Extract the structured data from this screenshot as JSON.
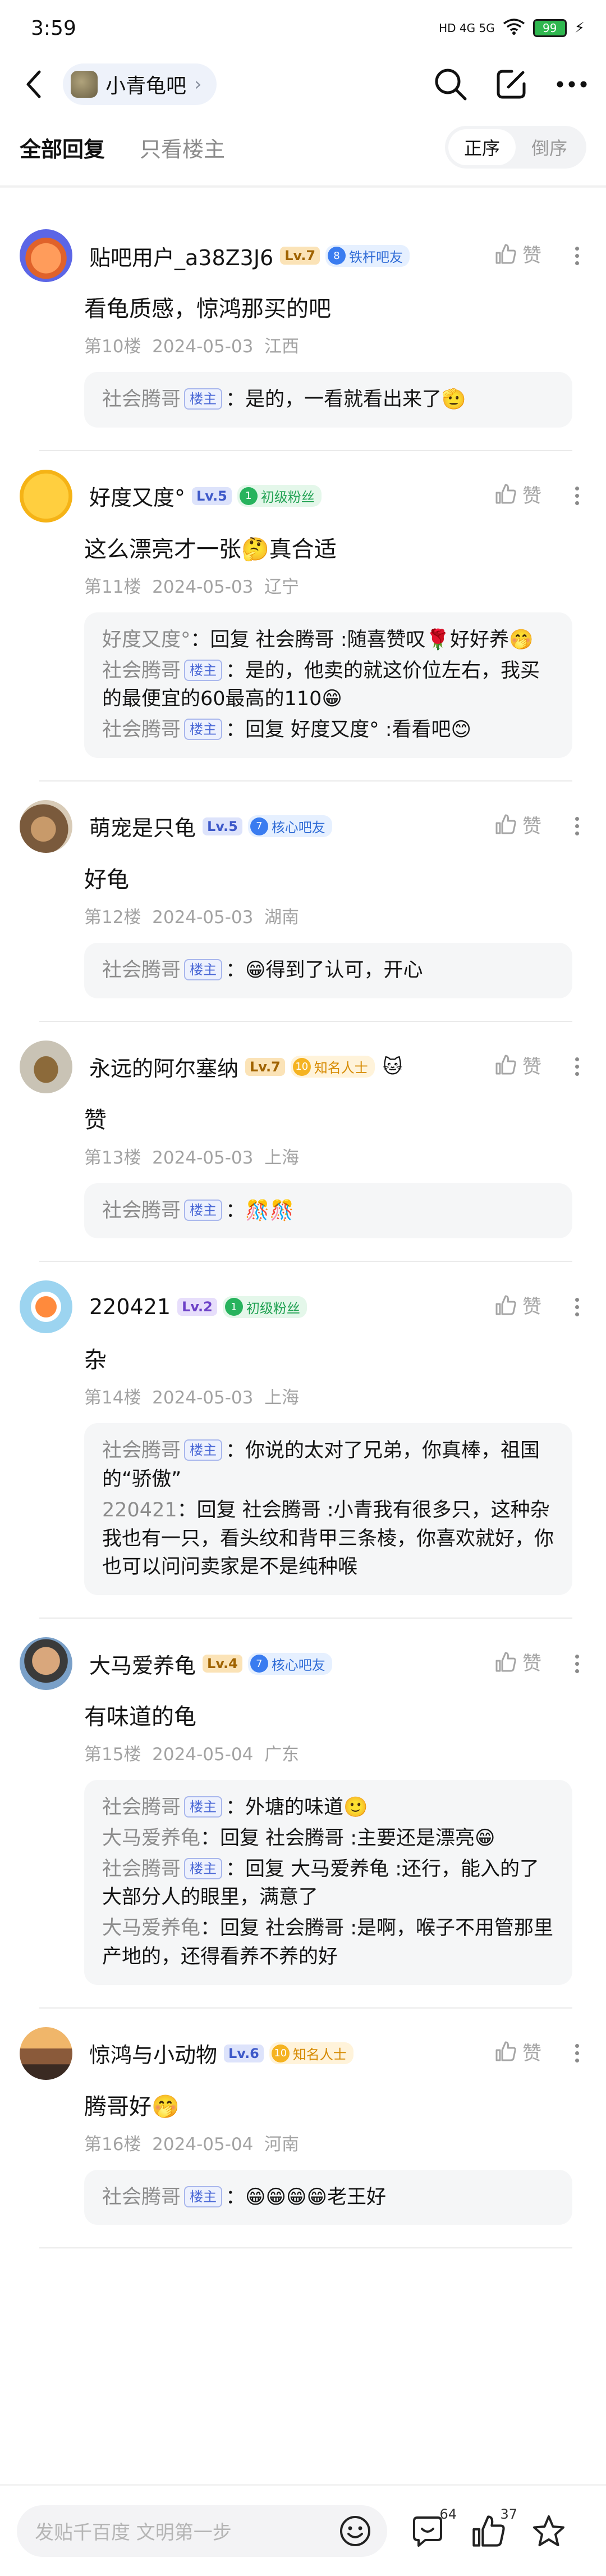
{
  "status": {
    "time": "3:59",
    "signal": "HD 4G 5G",
    "battery": "99"
  },
  "nav": {
    "forum_name": "小青龟吧",
    "chevron": "›"
  },
  "filters": {
    "tabs": [
      "全部回复",
      "只看楼主"
    ],
    "sort": [
      "正序",
      "倒序"
    ]
  },
  "posts": [
    {
      "username": "贴吧用户_a38Z3J6",
      "level": "Lv.7",
      "badge_num": "8",
      "badge": "铁杆吧友",
      "badge_extra": "",
      "like": "赞",
      "content": "看龟质感，惊鸿那买的吧",
      "floor": "第10楼",
      "date": "2024-05-03",
      "location": "江西",
      "replies": [
        {
          "name": "社会腾哥",
          "owner": "楼主",
          "text": "：是的，一看就看出来了🫡"
        }
      ]
    },
    {
      "username": "好度又度°",
      "level": "Lv.5",
      "badge_num": "1",
      "badge": "初级粉丝",
      "badge_extra": "",
      "like": "赞",
      "content": "这么漂亮才一张🤔真合适",
      "floor": "第11楼",
      "date": "2024-05-03",
      "location": "辽宁",
      "replies": [
        {
          "name": "好度又度°",
          "owner": "",
          "text": "：回复 社会腾哥 :随喜赞叹🌹好好养🤭"
        },
        {
          "name": "社会腾哥",
          "owner": "楼主",
          "text": "：是的，他卖的就这价位左右，我买的最便宜的60最高的110😁"
        },
        {
          "name": "社会腾哥",
          "owner": "楼主",
          "text": "：回复 好度又度° :看看吧😊"
        }
      ]
    },
    {
      "username": "萌宠是只龟",
      "level": "Lv.5",
      "badge_num": "7",
      "badge": "核心吧友",
      "badge_extra": "",
      "like": "赞",
      "content": "好龟",
      "floor": "第12楼",
      "date": "2024-05-03",
      "location": "湖南",
      "replies": [
        {
          "name": "社会腾哥",
          "owner": "楼主",
          "text": "：😁得到了认可，开心"
        }
      ]
    },
    {
      "username": "永远的阿尔塞纳",
      "level": "Lv.7",
      "badge_num": "10",
      "badge": "知名人士",
      "badge_extra": "🐱",
      "like": "赞",
      "content": "赞",
      "floor": "第13楼",
      "date": "2024-05-03",
      "location": "上海",
      "replies": [
        {
          "name": "社会腾哥",
          "owner": "楼主",
          "text": "：🎊🎊"
        }
      ]
    },
    {
      "username": "220421",
      "level": "Lv.2",
      "badge_num": "1",
      "badge": "初级粉丝",
      "badge_extra": "",
      "like": "赞",
      "content": "杂",
      "floor": "第14楼",
      "date": "2024-05-03",
      "location": "上海",
      "replies": [
        {
          "name": "社会腾哥",
          "owner": "楼主",
          "text": "：你说的太对了兄弟，你真棒，祖国的“骄傲”"
        },
        {
          "name": "220421",
          "owner": "",
          "text": "：回复 社会腾哥 :小青我有很多只，这种杂我也有一只，看头纹和背甲三条棱，你喜欢就好，你也可以问问卖家是不是纯种喉"
        }
      ]
    },
    {
      "username": "大马爱养龟",
      "level": "Lv.4",
      "badge_num": "7",
      "badge": "核心吧友",
      "badge_extra": "",
      "like": "赞",
      "content": "有味道的龟",
      "floor": "第15楼",
      "date": "2024-05-04",
      "location": "广东",
      "replies": [
        {
          "name": "社会腾哥",
          "owner": "楼主",
          "text": "：外塘的味道🙂"
        },
        {
          "name": "大马爱养龟",
          "owner": "",
          "text": "：回复 社会腾哥 :主要还是漂亮😁"
        },
        {
          "name": "社会腾哥",
          "owner": "楼主",
          "text": "：回复 大马爱养龟 :还行，能入的了大部分人的眼里，满意了"
        },
        {
          "name": "大马爱养龟",
          "owner": "",
          "text": "：回复 社会腾哥 :是啊，喉子不用管那里产地的，还得看养不养的好"
        }
      ]
    },
    {
      "username": "惊鸿与小动物",
      "level": "Lv.6",
      "badge_num": "10",
      "badge": "知名人士",
      "badge_extra": "",
      "like": "赞",
      "content": "腾哥好🤭",
      "floor": "第16楼",
      "date": "2024-05-04",
      "location": "河南",
      "replies": [
        {
          "name": "社会腾哥",
          "owner": "楼主",
          "text": "：😁😁😁😁老王好"
        }
      ]
    }
  ],
  "bottom": {
    "placeholder": "发贴千百度 文明第一步",
    "comment_count": "64",
    "like_count": "37"
  },
  "colors": {
    "accent": "#3a7cf0",
    "meta": "#a3a3a3",
    "reply_bg": "#f5f6f7"
  }
}
